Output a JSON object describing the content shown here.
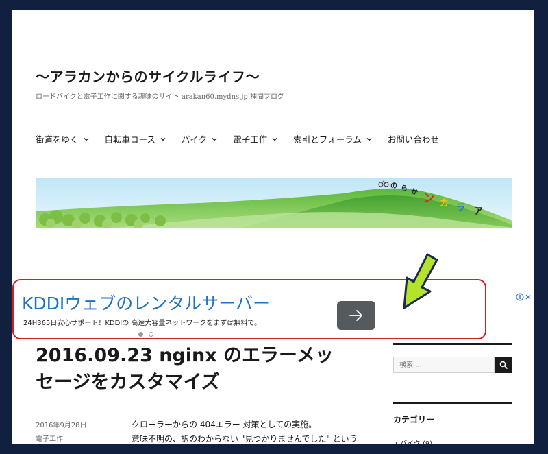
{
  "site": {
    "title": "〜アラカンからのサイクルライフ〜",
    "description": "ロードバイクと電子工作に関する趣味のサイト arakan60.mydns.jp 補間ブログ"
  },
  "nav": {
    "items": [
      {
        "label": "街道をゆく",
        "dropdown": true
      },
      {
        "label": "自転車コース",
        "dropdown": true
      },
      {
        "label": "バイク",
        "dropdown": true
      },
      {
        "label": "電子工作",
        "dropdown": true
      },
      {
        "label": "索引とフォーラム",
        "dropdown": true
      },
      {
        "label": "お問い合わせ",
        "dropdown": false
      }
    ]
  },
  "header_image": {
    "logo_chars": [
      "の",
      "ら",
      "か",
      "ン",
      "カ",
      "ラ",
      "ア"
    ],
    "logo_colors": [
      "#222222",
      "#222222",
      "#222222",
      "#e8202a",
      "#f5c400",
      "#2a6fd6",
      "#222222"
    ]
  },
  "ad": {
    "headline": "KDDIウェブのレンタルサーバー",
    "sub": "24H365日安心サポート！KDDIの 高速大容量ネットワークをまずは無料で。",
    "arrow_icon": "arrow-right-icon",
    "adchoices_icon": "adchoices-icon",
    "accent": "#1e73c8",
    "border_color": "#d0202a"
  },
  "post": {
    "title_line1": "2016.09.23 nginx のエラーメッ",
    "title_line2": "セージをカスタマイズ",
    "date": "2016年9月28日",
    "category": "電子工作",
    "body_line1": "クローラーからの 404エラー 対策としての実施。",
    "body_line2": "意味不明の、訳のわからない \"見つかりませんでした\" という"
  },
  "sidebar": {
    "search_placeholder": "検索 …",
    "categories_heading": "カテゴリー",
    "category_item": "・バイク (9)"
  }
}
